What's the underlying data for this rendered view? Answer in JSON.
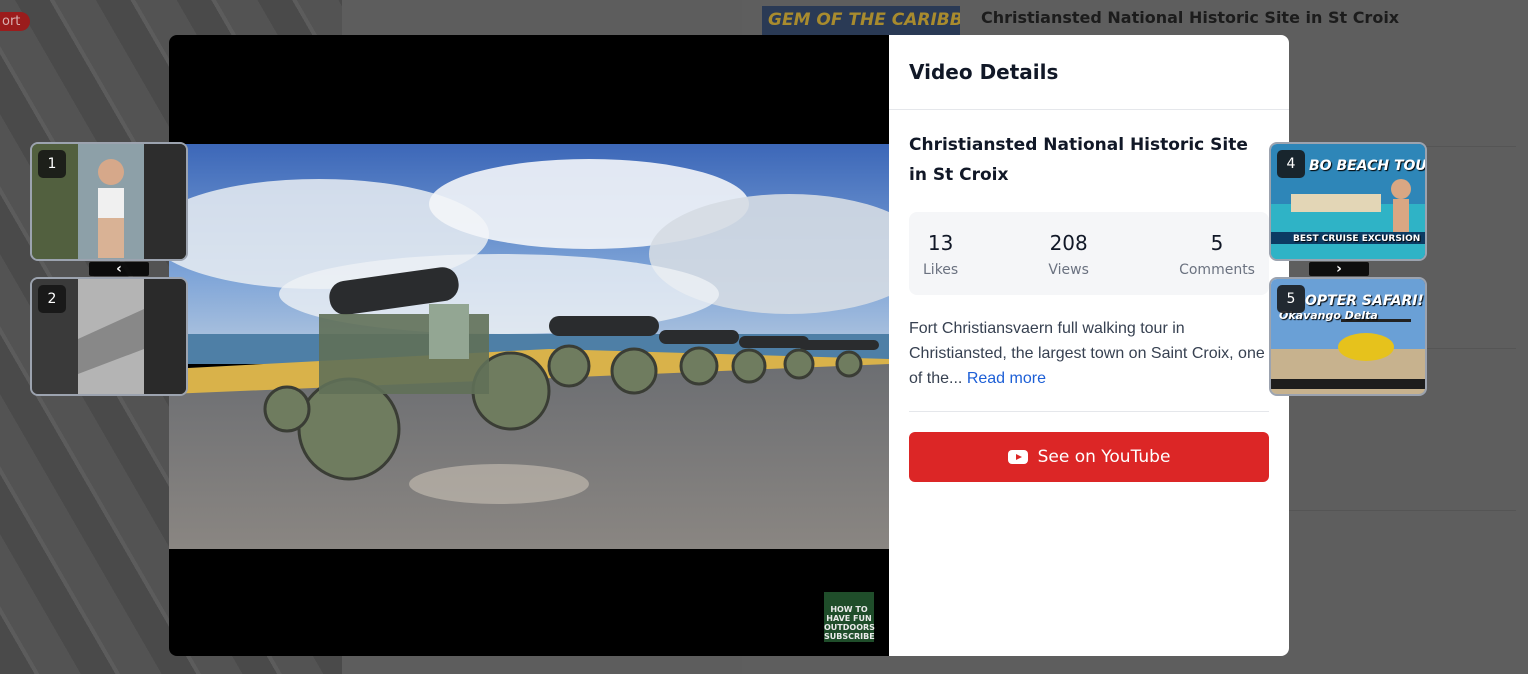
{
  "background": {
    "badge_text": "ort",
    "thumb_caption": "GEM OF THE CARIBBEAN!",
    "right_title": "Christiansted National Historic Site in St Croix"
  },
  "details": {
    "heading": "Video Details",
    "video_title": "Christiansted National Historic Site in St Croix",
    "stats": [
      {
        "value": "13",
        "label": "Likes"
      },
      {
        "value": "208",
        "label": "Views"
      },
      {
        "value": "5",
        "label": "Comments"
      }
    ],
    "description": "Fort Christiansvaern full walking tour in Christiansted, the largest town on Saint Croix, one of the...",
    "read_more": "Read more",
    "youtube_button": "See on YouTube"
  },
  "player": {
    "channel_mark": "HOW TO HAVE FUN OUTDOORS SUBSCRIBE"
  },
  "left_thumbs": [
    {
      "number": "1"
    },
    {
      "number": "2"
    }
  ],
  "right_thumbs": [
    {
      "number": "4",
      "caption": "BO BEACH TOUR!",
      "subcaption": "BEST CRUISE EXCURSION"
    },
    {
      "number": "5",
      "caption": "OPTER SAFARI!",
      "subcaption": "Okavango Delta"
    }
  ],
  "nav": {
    "prev_glyph": "‹",
    "next_glyph": "›"
  },
  "colors": {
    "accent_red": "#dc2626",
    "link_blue": "#1d5fd6"
  }
}
